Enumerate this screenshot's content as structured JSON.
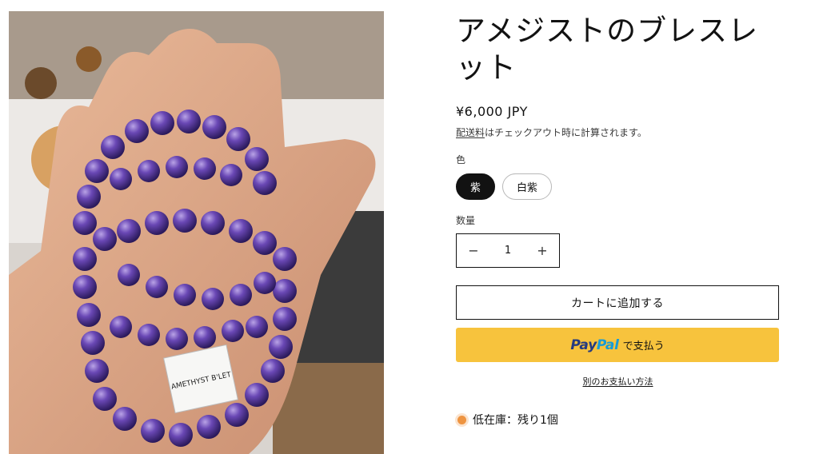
{
  "product": {
    "title": "アメジストのブレスレット",
    "price": "¥6,000 JPY",
    "shipping_link": "配送料",
    "shipping_text": "はチェックアウト時に計算されます。",
    "photo_tag_text": "AMETHYST B'LET"
  },
  "variant": {
    "label": "色",
    "options": [
      "紫",
      "白紫"
    ],
    "selected": "紫"
  },
  "quantity": {
    "label": "数量",
    "value": "1",
    "decrease_symbol": "−",
    "increase_symbol": "+"
  },
  "actions": {
    "add_to_cart": "カートに追加する",
    "paypal_part1": "Pay",
    "paypal_part2": "Pal",
    "paypal_suffix": "で支払う",
    "more_payment": "別のお支払い方法"
  },
  "stock": {
    "text": "低在庫：残り1個"
  },
  "colors": {
    "paypal_bg": "#f7c33d",
    "paypal_dark_blue": "#253b80",
    "paypal_light_blue": "#179bd7",
    "selected_pill_bg": "#121212",
    "low_stock_dot": "#ee9441"
  }
}
